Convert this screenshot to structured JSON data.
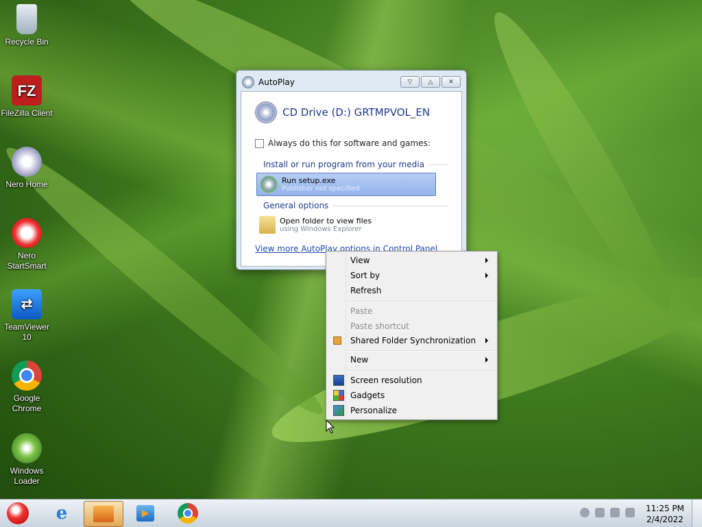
{
  "desktop_icons": [
    {
      "label": "Recycle Bin",
      "icon": "recycle-bin-icon"
    },
    {
      "label": "FileZilla Client",
      "icon": "filezilla-icon"
    },
    {
      "label": "Nero Home",
      "icon": "nero-home-icon"
    },
    {
      "label": "Nero StartSmart",
      "icon": "nero-startsmart-icon"
    },
    {
      "label": "TeamViewer 10",
      "icon": "teamviewer-icon"
    },
    {
      "label": "Google Chrome",
      "icon": "chrome-icon"
    },
    {
      "label": "Windows Loader",
      "icon": "windows-loader-icon"
    }
  ],
  "autoplay": {
    "title": "AutoPlay",
    "drive": "CD Drive (D:) GRTMPVOL_EN",
    "always_label": "Always do this for software and games:",
    "section_install": "Install or run program from your media",
    "run_main": "Run setup.exe",
    "run_sub": "Publisher not specified",
    "section_general": "General options",
    "open_main": "Open folder to view files",
    "open_sub": "using Windows Explorer",
    "link": "View more AutoPlay options in Control Panel"
  },
  "context_menu": {
    "view": "View",
    "sort_by": "Sort by",
    "refresh": "Refresh",
    "paste": "Paste",
    "paste_shortcut": "Paste shortcut",
    "shared_sync": "Shared Folder Synchronization",
    "new": "New",
    "screen_resolution": "Screen resolution",
    "gadgets": "Gadgets",
    "personalize": "Personalize"
  },
  "taskbar": {
    "time": "11:25 PM",
    "date": "2/4/2022"
  },
  "colors": {
    "accent_link": "#1c48b4",
    "selection": "#94b3ec",
    "title_text": "#1e3a8c"
  }
}
